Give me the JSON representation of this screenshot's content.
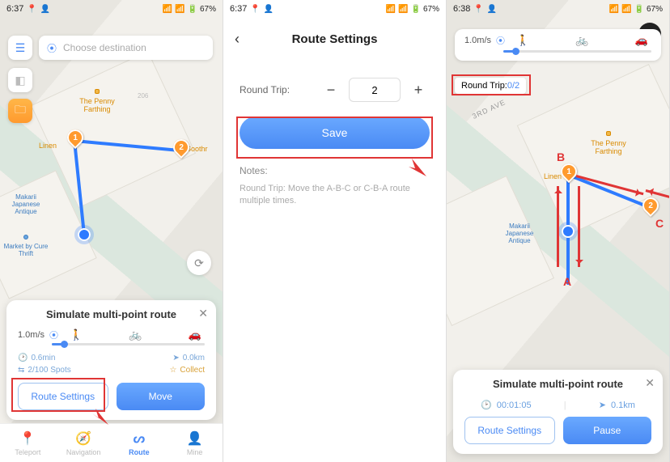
{
  "status": {
    "time1": "6:37",
    "time2": "6:37",
    "time3": "6:38",
    "battery": "67%"
  },
  "screen1": {
    "search_placeholder": "Choose destination",
    "places": {
      "penny": "The Penny Farthing",
      "linen": "Linen",
      "soothr": "Soothr",
      "makarii": "Makarii Japanese Antique",
      "market": "Market by Cure Thrift",
      "addr_206": "206"
    },
    "panel_title": "Simulate multi-point route",
    "speed": "1.0m/s",
    "stats": {
      "duration": "0.6min",
      "distance": "0.0km",
      "spots": "2/100 Spots",
      "collect": "Collect"
    },
    "route_settings": "Route Settings",
    "move": "Move",
    "nav": {
      "teleport": "Teleport",
      "navigation": "Navigation",
      "route": "Route",
      "mine": "Mine"
    }
  },
  "screen2": {
    "title": "Route Settings",
    "round_trip_label": "Round Trip:",
    "round_trip_value": "2",
    "save": "Save",
    "notes_label": "Notes:",
    "notes_text": "Round Trip: Move the A-B-C or C-B-A route multiple times."
  },
  "screen3": {
    "speed": "1.0m/s",
    "rt_label": "Round Trip:",
    "rt_value": "0/2",
    "road": "3RD AVE",
    "places": {
      "penny": "The Penny Farthing",
      "linen": "Linen",
      "makarii": "Makarii Japanese Antique"
    },
    "letters": {
      "a": "A",
      "b": "B",
      "c": "C"
    },
    "panel_title": "Simulate multi-point route",
    "timer": "00:01:05",
    "distance": "0.1km",
    "route_settings": "Route Settings",
    "pause": "Pause"
  }
}
